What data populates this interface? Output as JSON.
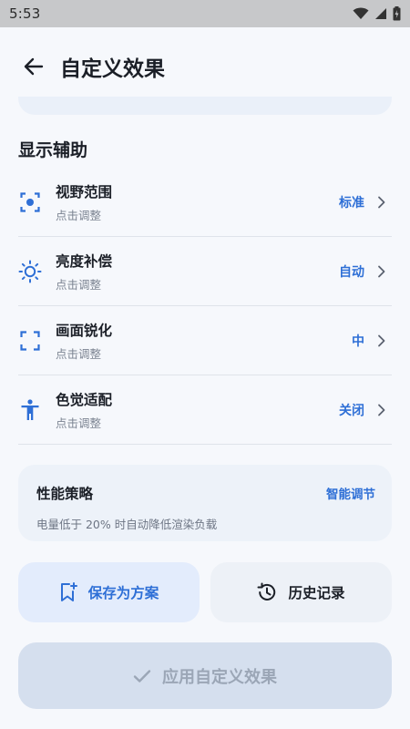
{
  "status_bar": {
    "time": "5:53"
  },
  "app_bar": {
    "title": "自定义效果"
  },
  "section": {
    "title": "显示辅助"
  },
  "settings": [
    {
      "title": "视野范围",
      "subtitle": "点击调整",
      "value": "标准",
      "icon": "focus-icon"
    },
    {
      "title": "亮度补偿",
      "subtitle": "点击调整",
      "value": "自动",
      "icon": "brightness-icon"
    },
    {
      "title": "画面锐化",
      "subtitle": "点击调整",
      "value": "中",
      "icon": "frame-corners-icon"
    },
    {
      "title": "色觉适配",
      "subtitle": "点击调整",
      "value": "关闭",
      "icon": "accessibility-icon"
    }
  ],
  "performance": {
    "title": "性能策略",
    "mode": "智能调节",
    "description": "电量低于 20% 时自动降低渲染负载"
  },
  "buttons": {
    "save_preset": "保存为方案",
    "history": "历史记录",
    "apply": "应用自定义效果"
  },
  "colors": {
    "accent": "#2e6fd6",
    "background": "#f6f8fc",
    "apply_disabled": "#d5dfee"
  }
}
